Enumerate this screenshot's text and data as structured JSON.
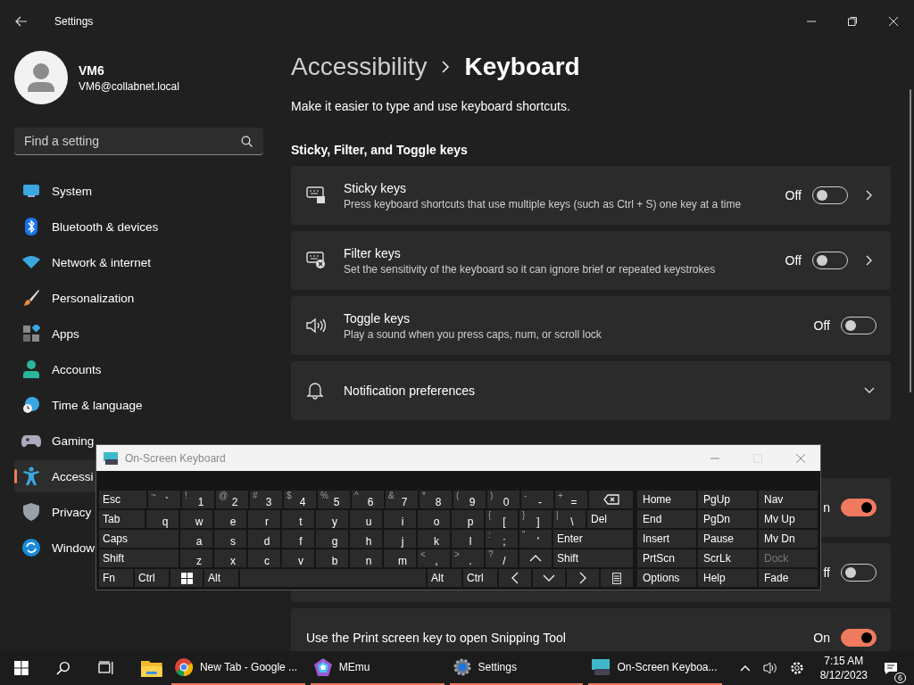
{
  "window": {
    "title": "Settings"
  },
  "profile": {
    "name": "VM6",
    "email": "VM6@collabnet.local"
  },
  "search": {
    "placeholder": "Find a setting"
  },
  "nav": [
    {
      "label": "System",
      "selected": false
    },
    {
      "label": "Bluetooth & devices",
      "selected": false
    },
    {
      "label": "Network & internet",
      "selected": false
    },
    {
      "label": "Personalization",
      "selected": false
    },
    {
      "label": "Apps",
      "selected": false
    },
    {
      "label": "Accounts",
      "selected": false
    },
    {
      "label": "Time & language",
      "selected": false
    },
    {
      "label": "Gaming",
      "selected": false
    },
    {
      "label": "Accessi",
      "selected": true
    },
    {
      "label": "Privacy",
      "selected": false
    },
    {
      "label": "Window",
      "selected": false
    }
  ],
  "breadcrumb": {
    "parent": "Accessibility",
    "current": "Keyboard"
  },
  "description": "Make it easier to type and use keyboard shortcuts.",
  "section": "Sticky, Filter, and Toggle keys",
  "settings": [
    {
      "kind": "toggle",
      "title": "Sticky keys",
      "subtitle": "Press keyboard shortcuts that use multiple keys (such as Ctrl + S) one key at a time",
      "state": "Off",
      "on": false,
      "chevron": true
    },
    {
      "kind": "toggle",
      "title": "Filter keys",
      "subtitle": "Set the sensitivity of the keyboard so it can ignore brief or repeated keystrokes",
      "state": "Off",
      "on": false,
      "chevron": true
    },
    {
      "kind": "toggle",
      "title": "Toggle keys",
      "subtitle": "Play a sound when you press caps, num, or scroll lock",
      "state": "Off",
      "on": false,
      "chevron": false
    },
    {
      "kind": "expander",
      "title": "Notification preferences",
      "expanded": false
    }
  ],
  "more_settings": [
    {
      "state": "n",
      "on": true
    },
    {
      "state": "ff",
      "on": false
    },
    {
      "title": "Use the Print screen key to open Snipping Tool",
      "state": "On",
      "on": true
    }
  ],
  "osk": {
    "title": "On-Screen Keyboard",
    "rows": [
      {
        "keys": [
          {
            "kind": "mod",
            "label": "Esc"
          },
          {
            "kind": "char",
            "shift": "~",
            "main": "`"
          },
          {
            "kind": "char",
            "shift": "!",
            "main": "1"
          },
          {
            "kind": "char",
            "shift": "@",
            "main": "2"
          },
          {
            "kind": "char",
            "shift": "#",
            "main": "3"
          },
          {
            "kind": "char",
            "shift": "$",
            "main": "4"
          },
          {
            "kind": "char",
            "shift": "%",
            "main": "5"
          },
          {
            "kind": "char",
            "shift": "^",
            "main": "6"
          },
          {
            "kind": "char",
            "shift": "&",
            "main": "7"
          },
          {
            "kind": "char",
            "shift": "*",
            "main": "8"
          },
          {
            "kind": "char",
            "shift": "(",
            "main": "9"
          },
          {
            "kind": "char",
            "shift": ")",
            "main": "0"
          },
          {
            "kind": "char",
            "shift": "-",
            "main": "-"
          },
          {
            "kind": "char",
            "shift": "+",
            "main": "="
          },
          {
            "kind": "backspace"
          }
        ]
      },
      {
        "keys": [
          {
            "kind": "mod",
            "label": "Tab"
          },
          {
            "kind": "char",
            "main": "q"
          },
          {
            "kind": "char",
            "main": "w"
          },
          {
            "kind": "char",
            "main": "e"
          },
          {
            "kind": "char",
            "main": "r"
          },
          {
            "kind": "char",
            "main": "t"
          },
          {
            "kind": "char",
            "main": "y"
          },
          {
            "kind": "char",
            "main": "u"
          },
          {
            "kind": "char",
            "main": "i"
          },
          {
            "kind": "char",
            "main": "o"
          },
          {
            "kind": "char",
            "main": "p"
          },
          {
            "kind": "char",
            "shift": "{",
            "main": "["
          },
          {
            "kind": "char",
            "shift": "}",
            "main": "]"
          },
          {
            "kind": "char",
            "shift": "|",
            "main": "\\"
          },
          {
            "kind": "mod",
            "label": "Del"
          }
        ]
      },
      {
        "keys": [
          {
            "kind": "mod",
            "label": "Caps"
          },
          {
            "kind": "char",
            "main": "a"
          },
          {
            "kind": "char",
            "main": "s"
          },
          {
            "kind": "char",
            "main": "d"
          },
          {
            "kind": "char",
            "main": "f"
          },
          {
            "kind": "char",
            "main": "g"
          },
          {
            "kind": "char",
            "main": "h"
          },
          {
            "kind": "char",
            "main": "j"
          },
          {
            "kind": "char",
            "main": "k"
          },
          {
            "kind": "char",
            "main": "l"
          },
          {
            "kind": "char",
            "shift": ":",
            "main": ";"
          },
          {
            "kind": "char",
            "shift": "\"",
            "main": "'"
          },
          {
            "kind": "mod",
            "label": "Enter"
          }
        ]
      },
      {
        "keys": [
          {
            "kind": "mod",
            "label": "Shift"
          },
          {
            "kind": "char",
            "main": "z"
          },
          {
            "kind": "char",
            "main": "x"
          },
          {
            "kind": "char",
            "main": "c"
          },
          {
            "kind": "char",
            "main": "v"
          },
          {
            "kind": "char",
            "main": "b"
          },
          {
            "kind": "char",
            "main": "n"
          },
          {
            "kind": "char",
            "main": "m"
          },
          {
            "kind": "char",
            "shift": "<",
            "main": ","
          },
          {
            "kind": "char",
            "shift": ">",
            "main": "."
          },
          {
            "kind": "char",
            "shift": "?",
            "main": "/"
          },
          {
            "kind": "up"
          },
          {
            "kind": "mod",
            "label": "Shift"
          }
        ]
      },
      {
        "keys": [
          {
            "kind": "mod",
            "label": "Fn"
          },
          {
            "kind": "mod",
            "label": "Ctrl"
          },
          {
            "kind": "windows"
          },
          {
            "kind": "mod",
            "label": "Alt"
          },
          {
            "kind": "space"
          },
          {
            "kind": "mod",
            "label": "Alt"
          },
          {
            "kind": "mod",
            "label": "Ctrl"
          },
          {
            "kind": "left"
          },
          {
            "kind": "down"
          },
          {
            "kind": "right"
          },
          {
            "kind": "menu"
          }
        ]
      }
    ],
    "side_keys": [
      [
        {
          "label": "Home",
          "disabled": false
        },
        {
          "label": "PgUp",
          "disabled": false
        },
        {
          "label": "Nav",
          "disabled": false
        }
      ],
      [
        {
          "label": "End",
          "disabled": false
        },
        {
          "label": "PgDn",
          "disabled": false
        },
        {
          "label": "Mv Up",
          "disabled": false
        }
      ],
      [
        {
          "label": "Insert",
          "disabled": false
        },
        {
          "label": "Pause",
          "disabled": false
        },
        {
          "label": "Mv Dn",
          "disabled": false
        }
      ],
      [
        {
          "label": "PrtScn",
          "disabled": false
        },
        {
          "label": "ScrLk",
          "disabled": false
        },
        {
          "label": "Dock",
          "disabled": true
        }
      ],
      [
        {
          "label": "Options",
          "disabled": false
        },
        {
          "label": "Help",
          "disabled": false
        },
        {
          "label": "Fade",
          "disabled": false
        }
      ]
    ]
  },
  "taskbar": {
    "apps": [
      {
        "label": "New Tab - Google ...",
        "running": true
      },
      {
        "label": "MEmu",
        "running": true
      },
      {
        "label": "Settings",
        "running": true
      },
      {
        "label": "On-Screen Keyboa...",
        "running": true
      }
    ],
    "time": "7:15 AM",
    "date": "8/12/2023",
    "notifications": "6"
  }
}
